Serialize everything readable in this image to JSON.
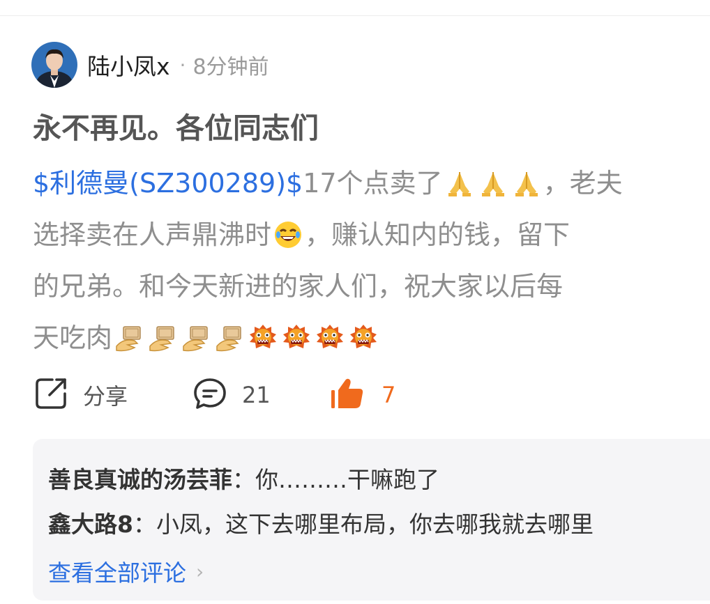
{
  "post": {
    "author_name": "陆小凤x",
    "separator": "·",
    "time": "8分钟前",
    "title": "永不再见。各位同志们",
    "body": {
      "line1": {
        "stock_link": "$利德曼(SZ300289)$",
        "text_after": "17个点卖了",
        "emojis": [
          "pray-emoji",
          "pray-emoji",
          "pray-emoji"
        ],
        "trailing": "，老夫"
      },
      "line2": {
        "text_before": "选择卖在人声鼎沸时",
        "emoji": "laugh-emoji",
        "text_after": "，赚认知内的钱，留下"
      },
      "line3": {
        "text": "的兄弟。和今天新进的家人们，祝大家以后每"
      },
      "line4": {
        "text": "天吃肉",
        "emojis": [
          "money-hand-emoji",
          "money-hand-emoji",
          "money-hand-emoji",
          "money-hand-emoji",
          "lion-dance-emoji",
          "lion-dance-emoji",
          "lion-dance-emoji",
          "lion-dance-emoji"
        ]
      }
    }
  },
  "actions": {
    "share_label": "分享",
    "comment_count": "21",
    "like_count": "7"
  },
  "comments": {
    "items": [
      {
        "user": "善良真诚的汤芸菲",
        "separator": "：",
        "text": "你………干嘛跑了"
      },
      {
        "user": "鑫大路8",
        "separator": "：",
        "text": "小凤，这下去哪里布局，你去哪我就去哪里"
      }
    ],
    "view_all_label": "查看全部评论"
  },
  "colors": {
    "link": "#2c6fe0",
    "like": "#f06a1d",
    "body_text": "#8e8e8e",
    "comment_bg": "#f5f5f7"
  }
}
